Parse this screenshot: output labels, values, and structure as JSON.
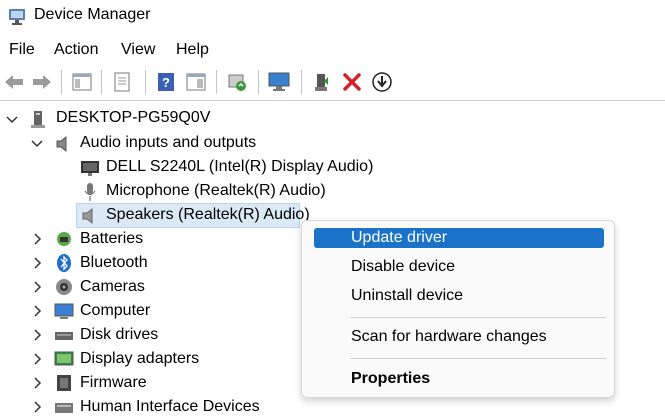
{
  "window": {
    "title": "Device Manager"
  },
  "menu": [
    "File",
    "Action",
    "View",
    "Help"
  ],
  "toolbar": {
    "icons": [
      "back-icon",
      "forward-icon",
      "properties-pane-icon",
      "document-icon",
      "help-icon",
      "view-pane-icon",
      "update-driver-icon",
      "monitor-scan-icon",
      "add-driver-icon",
      "uninstall-icon",
      "download-icon"
    ]
  },
  "tree": {
    "root": "DESKTOP-PG59Q0V",
    "audio_category": "Audio inputs and outputs",
    "audio_devices": [
      "DELL S2240L (Intel(R) Display Audio)",
      "Microphone (Realtek(R) Audio)",
      "Speakers (Realtek(R) Audio)"
    ],
    "categories": [
      "Batteries",
      "Bluetooth",
      "Cameras",
      "Computer",
      "Disk drives",
      "Display adapters",
      "Firmware",
      "Human Interface Devices"
    ]
  },
  "context_menu": {
    "items": [
      "Update driver",
      "Disable device",
      "Uninstall device",
      "Scan for hardware changes",
      "Properties"
    ],
    "highlighted": "Update driver",
    "colors": {
      "highlight": "#1a73c8",
      "selection": "#dbe9f7"
    }
  }
}
